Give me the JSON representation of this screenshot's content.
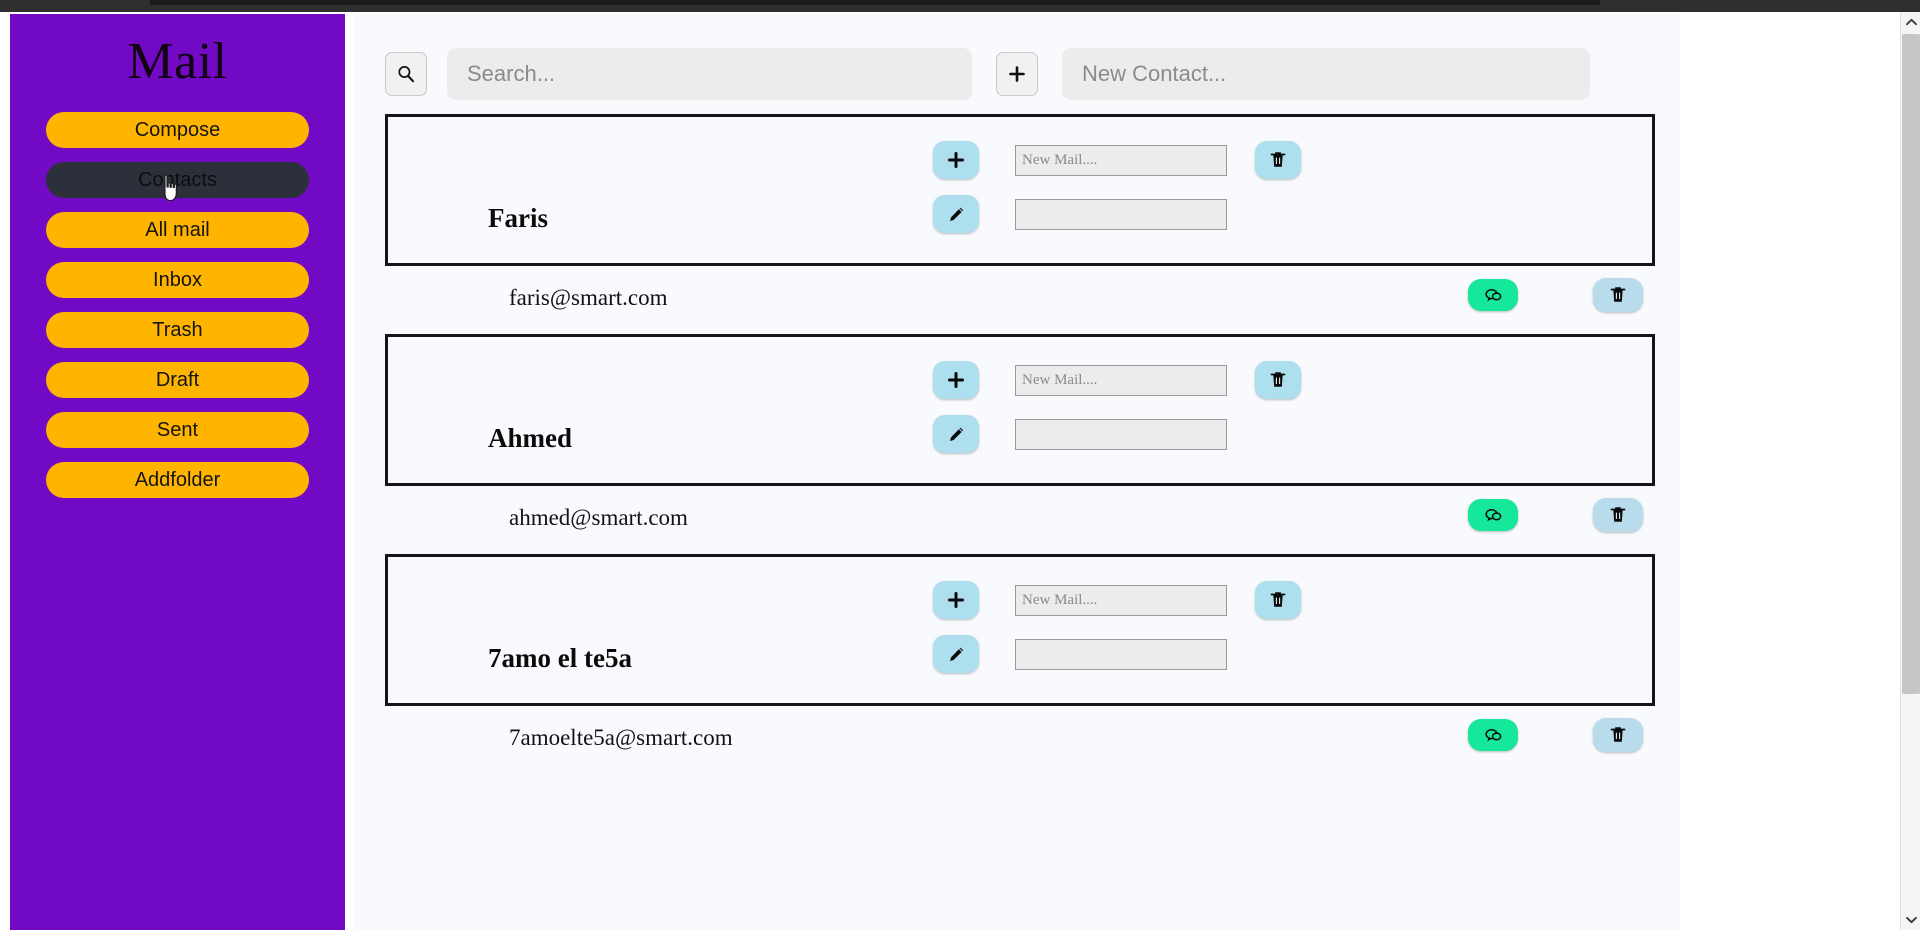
{
  "window": {
    "title_bar_color": "#2f2f2f"
  },
  "sidebar": {
    "brand": "Mail",
    "background_color": "#7209c4",
    "item_color": "#ffb400",
    "active_item_color": "#2b303a",
    "items": [
      {
        "label": "Compose",
        "active": false
      },
      {
        "label": "Contacts",
        "active": true
      },
      {
        "label": "All mail",
        "active": false
      },
      {
        "label": "Inbox",
        "active": false
      },
      {
        "label": "Trash",
        "active": false
      },
      {
        "label": "Draft",
        "active": false
      },
      {
        "label": "Sent",
        "active": false
      },
      {
        "label": "Addfolder",
        "active": false
      }
    ]
  },
  "toolbar": {
    "search_icon": "search-icon",
    "search": {
      "value": "",
      "placeholder": "Search..."
    },
    "add_icon": "plus-icon",
    "new_contact": {
      "value": "",
      "placeholder": "New Contact..."
    }
  },
  "contacts": [
    {
      "name": "Faris",
      "email": "faris@smart.com",
      "new_mail_input": {
        "value": "",
        "placeholder": "New Mail...."
      },
      "edit_input": {
        "value": "",
        "placeholder": ""
      },
      "add_icon": "plus-icon",
      "edit_icon": "pencil-icon",
      "delete_icon": "trash-icon",
      "chat_icon": "chat-bubble-icon",
      "row_delete_icon": "trash-icon"
    },
    {
      "name": "Ahmed",
      "email": "ahmed@smart.com",
      "new_mail_input": {
        "value": "",
        "placeholder": "New Mail...."
      },
      "edit_input": {
        "value": "",
        "placeholder": ""
      },
      "add_icon": "plus-icon",
      "edit_icon": "pencil-icon",
      "delete_icon": "trash-icon",
      "chat_icon": "chat-bubble-icon",
      "row_delete_icon": "trash-icon"
    },
    {
      "name": "7amo el te5a",
      "email": "7amoelte5a@smart.com",
      "new_mail_input": {
        "value": "",
        "placeholder": "New Mail...."
      },
      "edit_input": {
        "value": "",
        "placeholder": ""
      },
      "add_icon": "plus-icon",
      "edit_icon": "pencil-icon",
      "delete_icon": "trash-icon",
      "chat_icon": "chat-bubble-icon",
      "row_delete_icon": "trash-icon"
    }
  ],
  "colors": {
    "accent_purple": "#7209c4",
    "accent_orange": "#ffb400",
    "chat_green": "#15e79b",
    "button_blue": "#addfee",
    "panel_bg": "#f8fafd"
  },
  "scrollbar": {
    "up_arrow": "chevron-up-icon",
    "down_arrow": "chevron-down-icon"
  }
}
